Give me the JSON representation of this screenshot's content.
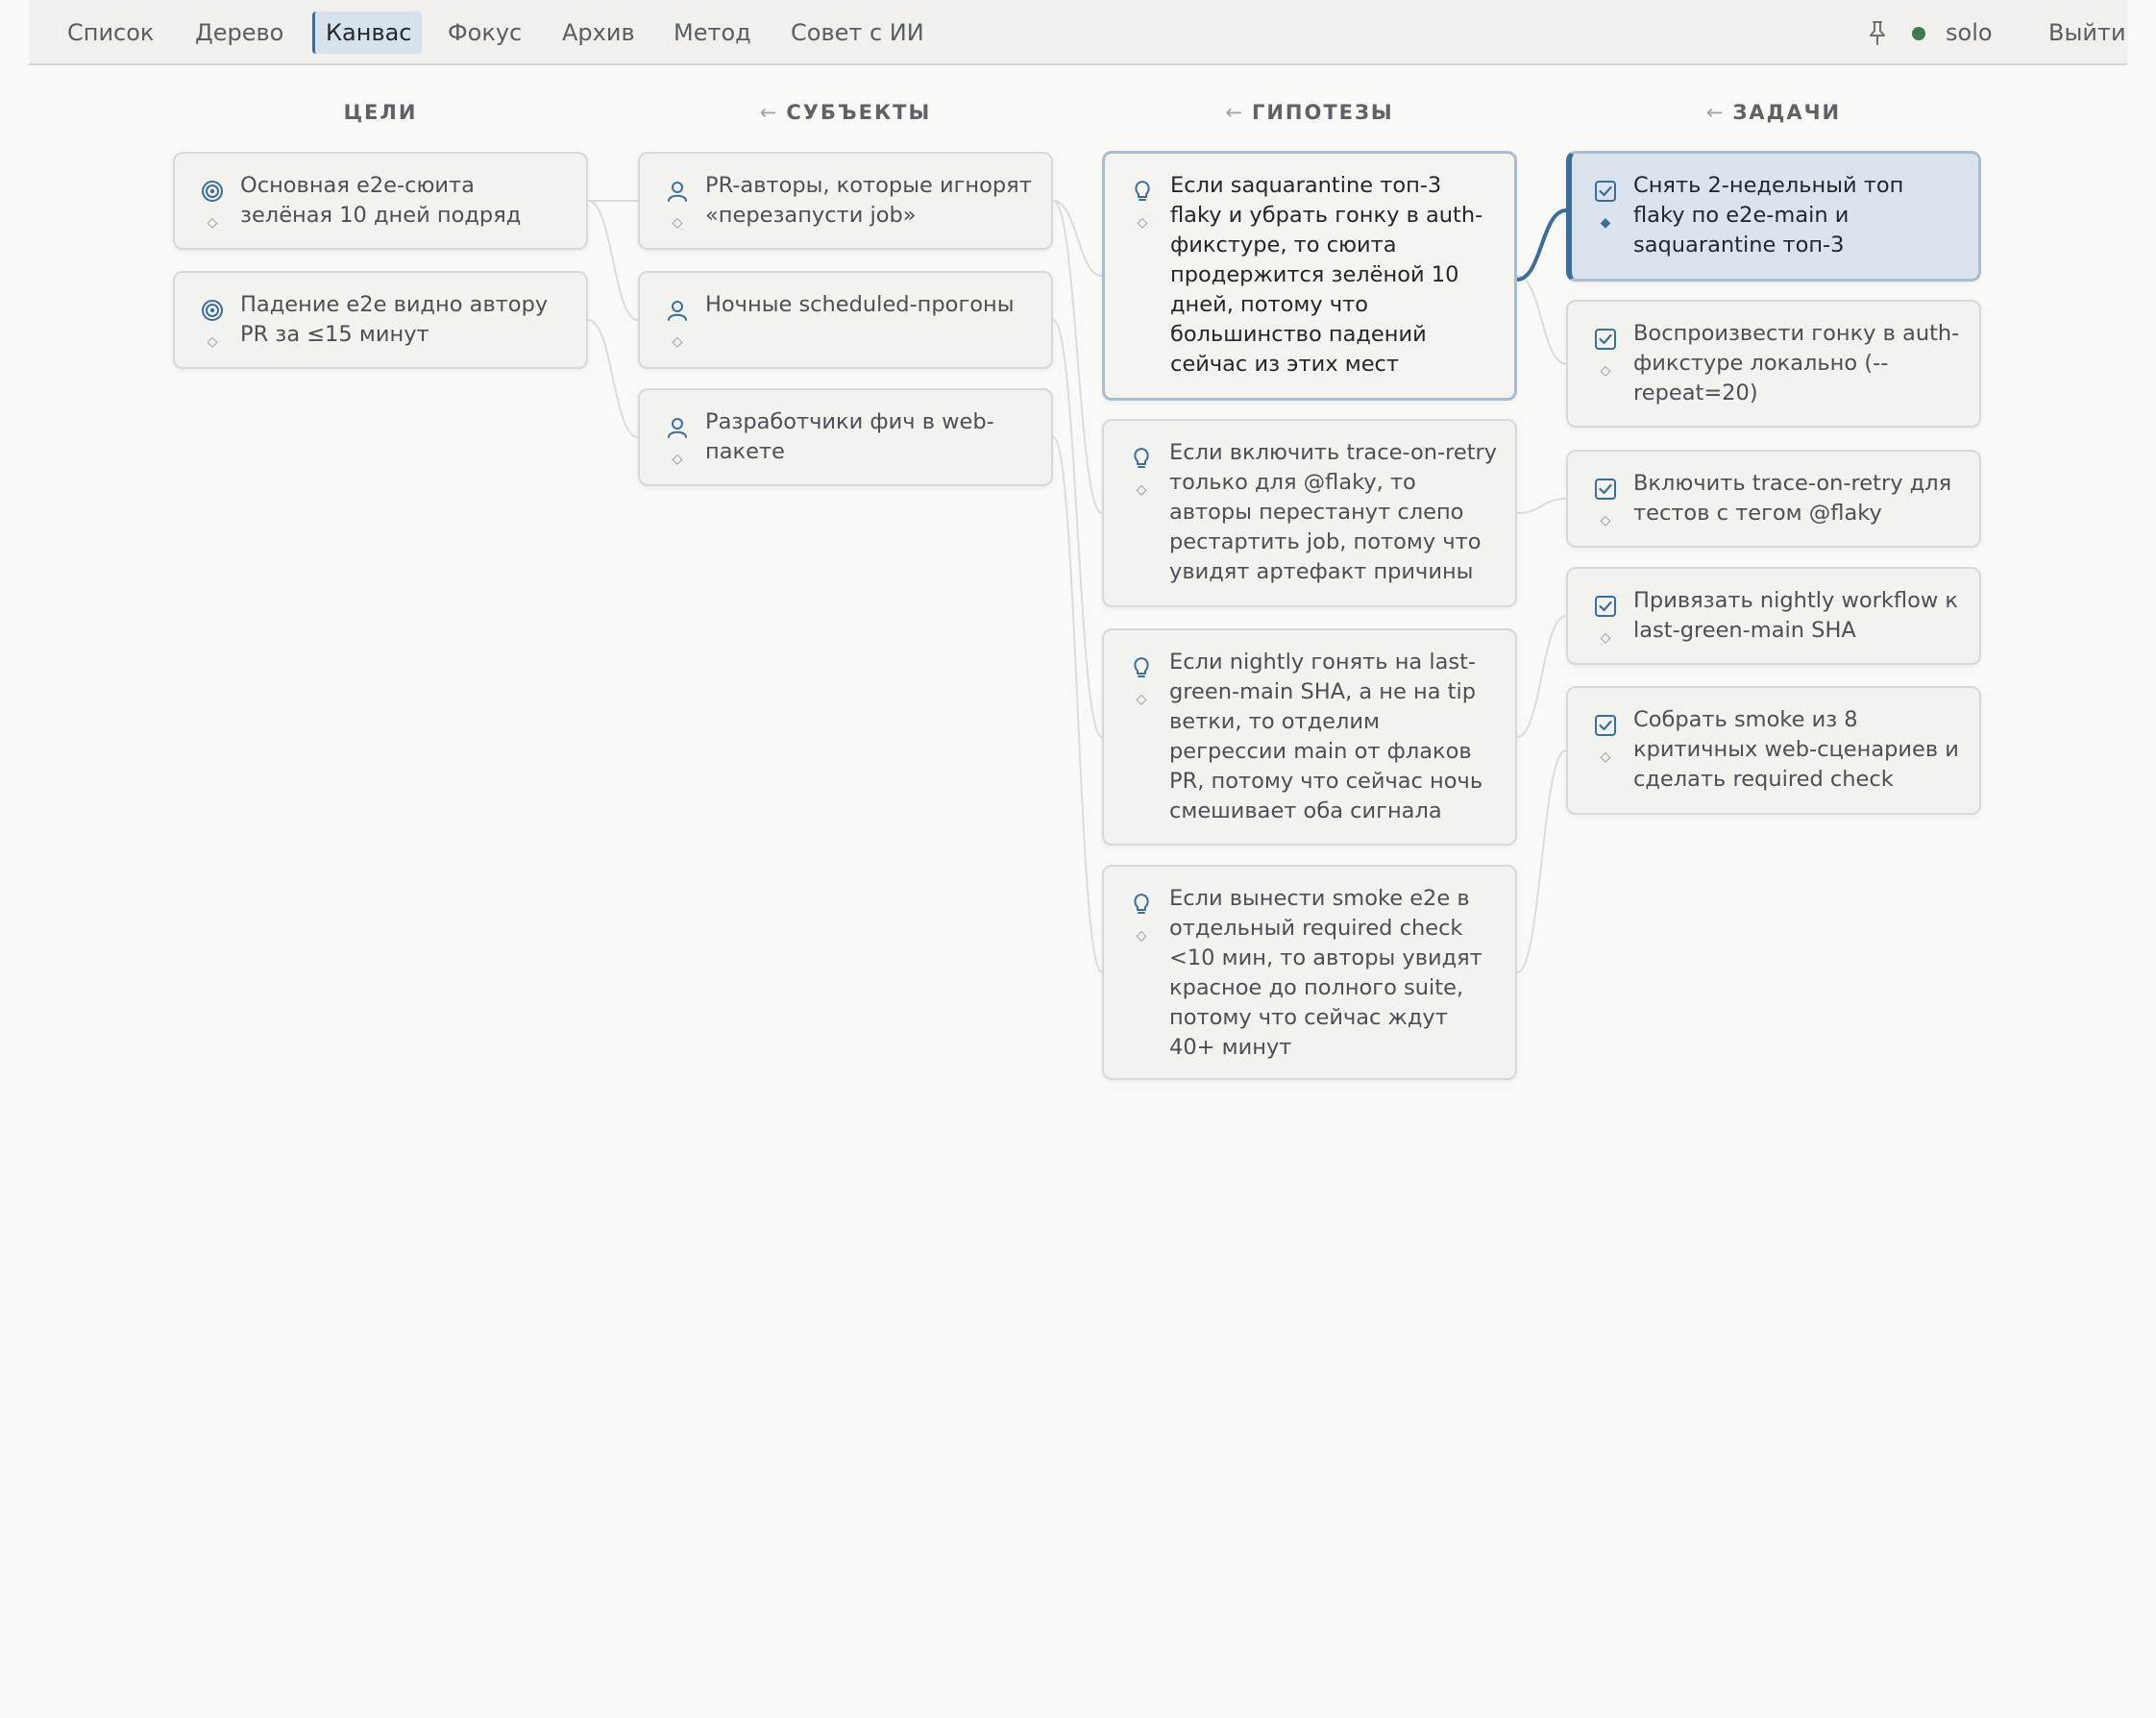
{
  "nav": {
    "tabs": [
      {
        "label": "Список",
        "active": false
      },
      {
        "label": "Дерево",
        "active": false
      },
      {
        "label": "Канвас",
        "active": true
      },
      {
        "label": "Фокус",
        "active": false
      },
      {
        "label": "Архив",
        "active": false
      },
      {
        "label": "Метод",
        "active": false
      },
      {
        "label": "Совет с ИИ",
        "active": false
      }
    ],
    "pin_icon": "pin-icon",
    "status_color": "#3f7a52",
    "user": "solo",
    "logout": "Выйти"
  },
  "colors": {
    "accent": "#3a6f9c",
    "selected_card": "#dbe4ed",
    "card": "#f2f2ee"
  },
  "columns": [
    {
      "title": "ЦЕЛИ",
      "arrow": "",
      "icon": "target-icon",
      "cards": [
        {
          "text": "Основная e2e-сюита зелёная 10 дней подряд"
        },
        {
          "text": "Падение e2e видно автору PR за ≤15 минут"
        }
      ]
    },
    {
      "title": "СУБЪЕКТЫ",
      "arrow": "←",
      "icon": "person-icon",
      "cards": [
        {
          "text": "PR-авторы, которые игнорят «перезапусти job»"
        },
        {
          "text": "Ночные scheduled-прогоны"
        },
        {
          "text": "Разработчики фич в web-пакете"
        }
      ]
    },
    {
      "title": "ГИПОТЕЗЫ",
      "arrow": "←",
      "icon": "lightbulb-icon",
      "cards": [
        {
          "text": "Если saquarantine топ-3 flaky и убрать гонку в auth-фикстуре, то сюита продержится зелёной 10 дней, потому что большинство падений сейчас из этих мест",
          "highlight": true
        },
        {
          "text": "Если включить trace-on-retry только для @flaky, то авторы перестанут слепо рестартить job, потому что увидят артефакт причины"
        },
        {
          "text": "Если nightly гонять на last-green-main SHA, а не на tip ветки, то отделим регрессии main от флаков PR, потому что сейчас ночь смешивает оба сигнала"
        },
        {
          "text": "Если вынести smoke e2e в отдельный required check <10 мин, то авторы увидят красное до полного suite, потому что сейчас ждут 40+ минут"
        }
      ]
    },
    {
      "title": "ЗАДАЧИ",
      "arrow": "←",
      "icon": "checkbox-icon",
      "cards": [
        {
          "text": "Снять 2-недельный топ flaky по e2e-main и saquarantine топ-3",
          "selected": true
        },
        {
          "text": "Воспроизвести гонку в auth-фикстуре локально (--repeat=20)"
        },
        {
          "text": "Включить trace-on-retry для тестов с тегом @flaky"
        },
        {
          "text": "Привязать nightly workflow к last-green-main SHA"
        },
        {
          "text": "Собрать smoke из 8 критичных web-сценариев и сделать required check"
        }
      ]
    }
  ]
}
